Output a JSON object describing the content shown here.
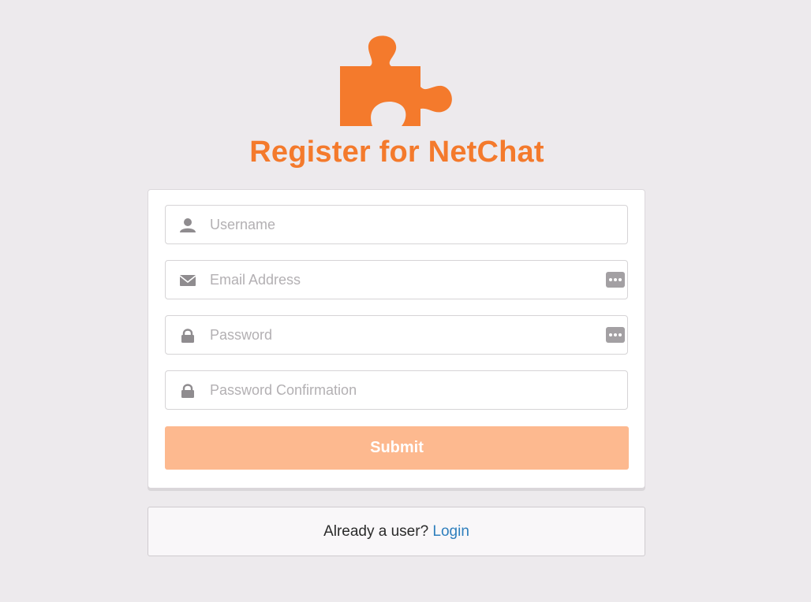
{
  "page": {
    "title": "Register for NetChat",
    "accent_color": "#f47a2c",
    "logo_icon": "puzzle-piece-icon"
  },
  "form": {
    "fields": [
      {
        "icon": "user-icon",
        "placeholder": "Username",
        "value": ""
      },
      {
        "icon": "envelope-icon",
        "placeholder": "Email Address",
        "value": "",
        "extra_icon": "password-manager-icon"
      },
      {
        "icon": "lock-icon",
        "placeholder": "Password",
        "value": "",
        "extra_icon": "password-manager-icon"
      },
      {
        "icon": "lock-icon",
        "placeholder": "Password Confirmation",
        "value": ""
      }
    ],
    "submit_label": "Submit",
    "submit_color": "#fdb98f"
  },
  "footer": {
    "prompt": "Already a user?",
    "login_label": "Login",
    "link_color": "#2f7fbd"
  }
}
